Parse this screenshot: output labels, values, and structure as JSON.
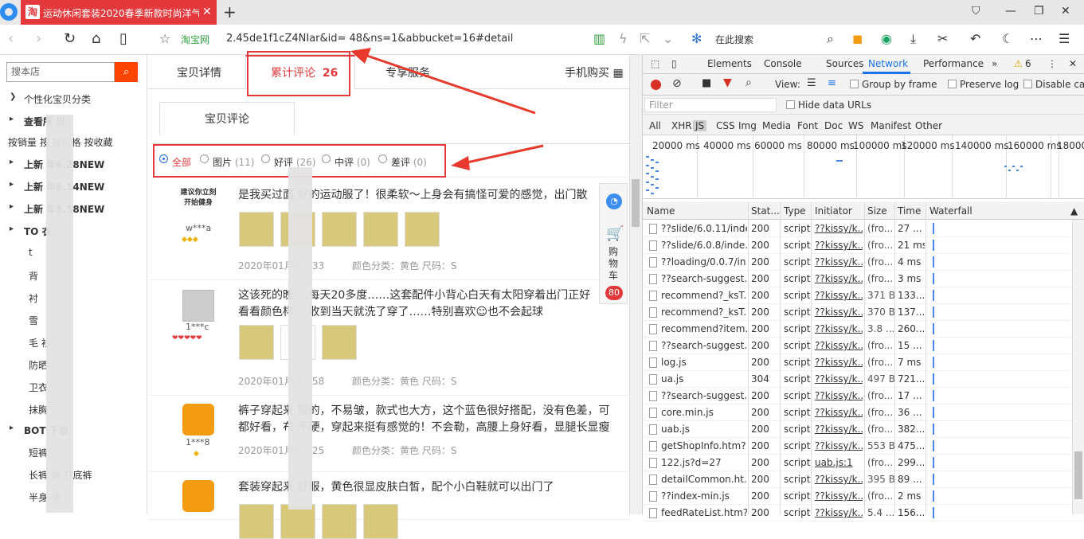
{
  "browser": {
    "tab_favicon": "淘",
    "tab_title": "运动休闲套装2020春季新款时尚洋气",
    "tab_close": "✕",
    "new_tab": "+",
    "site_label": "淘宝网",
    "url": "2.45de1f1cZ4NIar&id=                 48&ns=1&abbucket=16#detail",
    "search_placeholder": "在此搜索"
  },
  "sidebar": {
    "search_placeholder": "搜本店",
    "items": [
      {
        "label": "个性化宝贝分类",
        "bold": false
      },
      {
        "label": "查看所      贝",
        "bold": true
      },
      {
        "label": "按销量  按     按价格  按收藏",
        "bold": false
      },
      {
        "label": "上新     年6.28NEW",
        "bold": true
      },
      {
        "label": "上新     年6.14NEW",
        "bold": true
      },
      {
        "label": "上新     年5.18NEW",
        "bold": true
      },
      {
        "label": "TO      衣",
        "bold": true
      },
      {
        "label": "t",
        "bold": false
      },
      {
        "label": "背",
        "bold": false
      },
      {
        "label": "衬",
        "bold": false
      },
      {
        "label": "雪",
        "bold": false
      },
      {
        "label": "毛       衫",
        "bold": false
      },
      {
        "label": "防晒",
        "bold": false
      },
      {
        "label": "卫衣",
        "bold": false
      },
      {
        "label": "抹胸",
        "bold": false
      },
      {
        "label": "BOT       下装",
        "bold": true
      },
      {
        "label": "短裤",
        "bold": false
      },
      {
        "label": "长裤       裤  打底裤",
        "bold": false
      },
      {
        "label": "半身       裙",
        "bold": false
      }
    ]
  },
  "tabs": {
    "detail": "宝贝详情",
    "reviews": "累计评论",
    "reviews_count": "26",
    "service": "专享服务",
    "mobile": "手机购买"
  },
  "subtab": "宝贝评论",
  "filters": [
    {
      "label": "全部",
      "count": "",
      "selected": true
    },
    {
      "label": "图片",
      "count": "(11)",
      "selected": false
    },
    {
      "label": "好评",
      "count": "(26)",
      "selected": false
    },
    {
      "label": "中评",
      "count": "(0)",
      "selected": false
    },
    {
      "label": "差评",
      "count": "(0)",
      "selected": false
    }
  ],
  "reviews": [
    {
      "user": "w***a",
      "avatar_text": "建议你立刻开始健身",
      "text": "是我买过面      好的运动服了！很柔软～上身会有搞怪可爱的感觉，出门散",
      "text2": "",
      "date": "2020年01月      15:33",
      "sku": "颜色分类：黄色   尺码：S"
    },
    {
      "user": "1***c",
      "avatar_text": "",
      "text": "这该死的晚      …每天20多度……这套配件小背心白天有太阳穿着出门正好",
      "text2": "看看颜色样      …收到当天就洗了穿了……特别喜欢☺也不会起球",
      "date": "2020年01月      11:58",
      "sku": "颜色分类：黄色   尺码：S"
    },
    {
      "user": "1***8",
      "avatar_text": "",
      "text": "裤子穿起来      服的，不易皱，款式也大方，这个蓝色很好搭配，没有色差，可",
      "text2": "都好看，布      不硬，穿起来挺有感觉的！不会勒，高腰上身好看，显腿长显瘦",
      "date": "2020年01月      15:25",
      "sku": "颜色分类：黄色   尺码：S"
    },
    {
      "user": "",
      "avatar_text": "",
      "text": "套装穿起来      舒服，黄色很显皮肤白皙，配个小白鞋就可以出门了",
      "text2": "",
      "date": "",
      "sku": ""
    }
  ],
  "cart": {
    "label": "购物车",
    "count": "80"
  },
  "devtools": {
    "tabs": [
      "Elements",
      "Console",
      "Sources",
      "Network",
      "Performance"
    ],
    "more": "»",
    "warnings": "6",
    "toolbar": {
      "view": "View:",
      "group_by_frame": "Group by frame",
      "preserve_log": "Preserve log",
      "disable_cache": "Disable cac"
    },
    "filter_placeholder": "Filter",
    "hide_data_urls": "Hide data URLs",
    "types": [
      "All",
      "XHR",
      "JS",
      "CSS",
      "Img",
      "Media",
      "Font",
      "Doc",
      "WS",
      "Manifest",
      "Other"
    ],
    "timeline_labels": [
      "20000 ms",
      "40000 ms",
      "60000 ms",
      "80000 ms",
      "100000 ms",
      "120000 ms",
      "140000 ms",
      "160000 ms",
      "18000"
    ],
    "columns": [
      "Name",
      "Stat...",
      "Type",
      "Initiator",
      "Size",
      "Time",
      "Waterfall"
    ],
    "rows": [
      {
        "name": "??slide/6.0.11/inde...",
        "status": "200",
        "type": "script",
        "initiator": "??kissy/k...",
        "size": "(fro...",
        "time": "27 ..."
      },
      {
        "name": "??slide/6.0.8/inde...",
        "status": "200",
        "type": "script",
        "initiator": "??kissy/k...",
        "size": "(fro...",
        "time": "21 ms"
      },
      {
        "name": "??loading/0.0.7/in...",
        "status": "200",
        "type": "script",
        "initiator": "??kissy/k...",
        "size": "(fro...",
        "time": "4 ms"
      },
      {
        "name": "??search-suggest...",
        "status": "200",
        "type": "script",
        "initiator": "??kissy/k...",
        "size": "(fro...",
        "time": "3 ms"
      },
      {
        "name": "recommend?_ksT...",
        "status": "200",
        "type": "script",
        "initiator": "??kissy/k...",
        "size": "371 B",
        "time": "133..."
      },
      {
        "name": "recommend?_ksT...",
        "status": "200",
        "type": "script",
        "initiator": "??kissy/k...",
        "size": "370 B",
        "time": "137..."
      },
      {
        "name": "recommend?item...",
        "status": "200",
        "type": "script",
        "initiator": "??kissy/k...",
        "size": "3.8 ...",
        "time": "260..."
      },
      {
        "name": "??search-suggest...",
        "status": "200",
        "type": "script",
        "initiator": "??kissy/k...",
        "size": "(fro...",
        "time": "15 ..."
      },
      {
        "name": "log.js",
        "status": "200",
        "type": "script",
        "initiator": "??kissy/k...",
        "size": "(fro...",
        "time": "7 ms"
      },
      {
        "name": "ua.js",
        "status": "304",
        "type": "script",
        "initiator": "??kissy/k...",
        "size": "497 B",
        "time": "721..."
      },
      {
        "name": "??search-suggest...",
        "status": "200",
        "type": "script",
        "initiator": "??kissy/k...",
        "size": "(fro...",
        "time": "17 ..."
      },
      {
        "name": "core.min.js",
        "status": "200",
        "type": "script",
        "initiator": "??kissy/k...",
        "size": "(fro...",
        "time": "36 ..."
      },
      {
        "name": "uab.js",
        "status": "200",
        "type": "script",
        "initiator": "??kissy/k...",
        "size": "(fro...",
        "time": "382..."
      },
      {
        "name": "getShopInfo.htm?...",
        "status": "200",
        "type": "script",
        "initiator": "??kissy/k...",
        "size": "553 B",
        "time": "475..."
      },
      {
        "name": "122.js?d=27",
        "status": "200",
        "type": "script",
        "initiator": "uab.js:1",
        "size": "(fro...",
        "time": "299..."
      },
      {
        "name": "detailCommon.ht...",
        "status": "200",
        "type": "script",
        "initiator": "??kissy/k...",
        "size": "395 B",
        "time": "89 ..."
      },
      {
        "name": "??index-min.js",
        "status": "200",
        "type": "script",
        "initiator": "??kissy/k...",
        "size": "(fro...",
        "time": "2 ms"
      },
      {
        "name": "feedRateList.htm?...",
        "status": "200",
        "type": "script",
        "initiator": "??kissy/k...",
        "size": "5.4 ...",
        "time": "156..."
      }
    ]
  },
  "colors": {
    "accent": "#e4393c",
    "taobao_orange": "#ff4400",
    "network_blue": "#1a73e8"
  }
}
